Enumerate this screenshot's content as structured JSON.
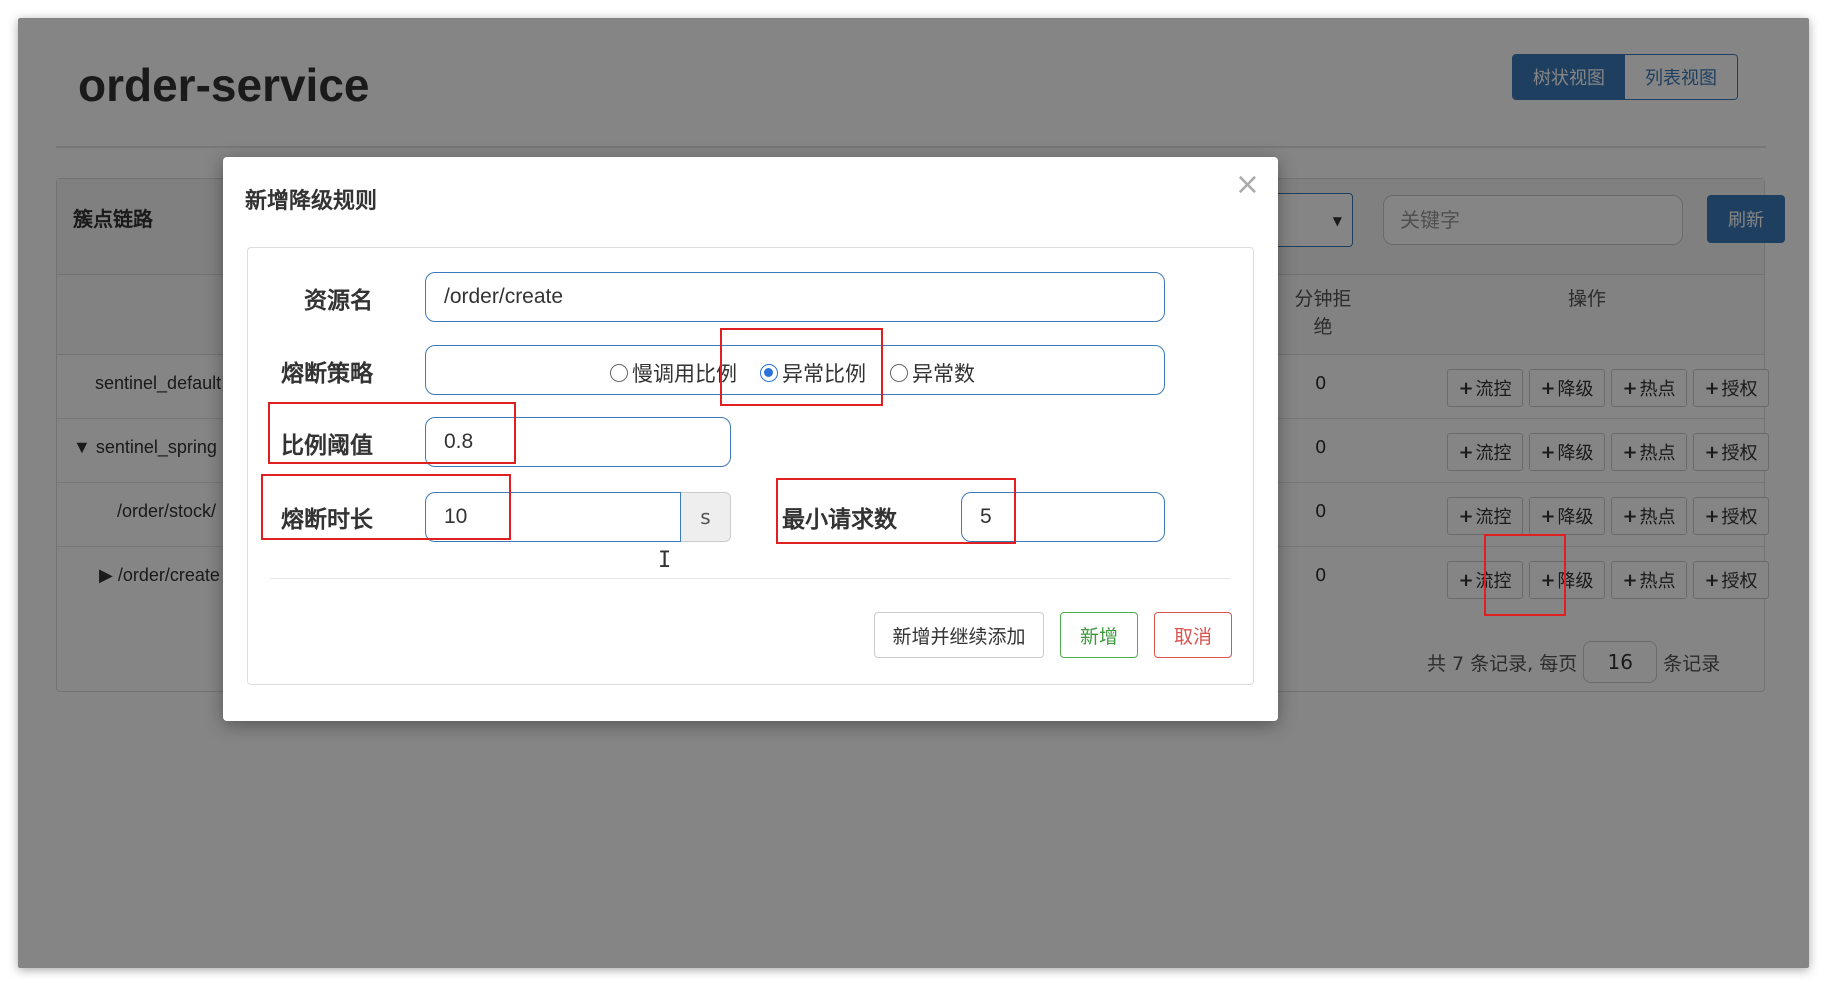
{
  "page": {
    "title": "order-service",
    "view_tabs": [
      "树状视图",
      "列表视图"
    ],
    "active_view": "树状视图"
  },
  "panel": {
    "title": "簇点链路",
    "keyword_placeholder": "关键字",
    "refresh_label": "刷新",
    "headers": {
      "block_per_min": "分钟拒绝",
      "operations": "操作"
    },
    "rows": [
      {
        "resource": "sentinel_default",
        "count": "0",
        "expander": ""
      },
      {
        "resource": "sentinel_spring",
        "count": "0",
        "expander": "▼"
      },
      {
        "resource": "/order/stock/",
        "count": "0",
        "expander": ""
      },
      {
        "resource": "/order/create",
        "count": "0",
        "expander": "▶"
      }
    ],
    "op_buttons": [
      "流控",
      "降级",
      "热点",
      "授权"
    ],
    "pager": {
      "prefix": "共 7 条记录, 每页",
      "page_size": "16",
      "suffix": "条记录"
    }
  },
  "modal": {
    "title": "新增降级规则",
    "close_symbol": "×",
    "resource_label": "资源名",
    "resource_value": "/order/create",
    "strategy_label": "熔断策略",
    "strategy_options": [
      "慢调用比例",
      "异常比例",
      "异常数"
    ],
    "strategy_selected": "异常比例",
    "ratio_label": "比例阈值",
    "ratio_value": "0.8",
    "duration_label": "熔断时长",
    "duration_value": "10",
    "duration_unit": "s",
    "min_request_label": "最小请求数",
    "min_request_value": "5",
    "buttons": {
      "add_continue": "新增并继续添加",
      "add": "新增",
      "cancel": "取消"
    }
  },
  "colors": {
    "primary": "#3c7ab8",
    "success": "#3c9a3c",
    "danger": "#d9534f",
    "annotation": "#e02020"
  }
}
